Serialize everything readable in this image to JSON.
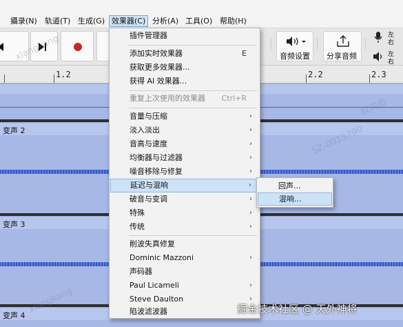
{
  "menubar": {
    "items": [
      {
        "label": "攝录(N)"
      },
      {
        "label": "轨道(T)"
      },
      {
        "label": "生成(G)"
      },
      {
        "label": "效果器(C)"
      },
      {
        "label": "分析(A)"
      },
      {
        "label": "工具(O)"
      },
      {
        "label": "帮助(H)"
      }
    ]
  },
  "toolbar": {
    "audio_settings_label": "音频设置",
    "share_audio_label": "分享音频",
    "left_label_1": "左",
    "right_label_1": "右",
    "left_label_2": "左",
    "right_label_2": "右"
  },
  "ruler": {
    "labels": [
      "1.2",
      "2.2",
      "2.3"
    ]
  },
  "tracks": [
    {
      "name": ""
    },
    {
      "name": "变声 2"
    },
    {
      "name": "变声 3"
    },
    {
      "name": "变声 4"
    }
  ],
  "effects_menu": {
    "plugin_manager": "插件管理器",
    "add_realtime": "添加实时效果器",
    "add_realtime_shortcut": "E",
    "get_more": "获取更多效果器...",
    "get_ai": "获得 AI 效果器...",
    "repeat_last": "重复上次使用的效果器",
    "repeat_last_shortcut": "Ctrl+R",
    "volume_compression": "音量与压缩",
    "fade": "淡入淡出",
    "pitch_tempo": "音高与速度",
    "eq_filters": "均衡器与过滤器",
    "noise_removal": "噪音移除与修复",
    "delay_reverb": "延迟与混响",
    "distortion": "破音与变调",
    "special": "特殊",
    "legacy": "传统",
    "clip_fix": "削波失真修复",
    "dominic": "Dominic Mazzoni",
    "vocoder": "声码器",
    "paul": "Paul Licameli",
    "steve": "Steve Daulton",
    "notch": "陷波滤波器"
  },
  "submenu": {
    "echo": "回声...",
    "reverb": "混响..."
  },
  "watermarks": {
    "wm1": "xiangkang",
    "wm2": "SZ-0015790",
    "wm3": "权向右",
    "wm4": "xiangkang"
  },
  "credit": "掘金技术社区 @ 天外神将"
}
